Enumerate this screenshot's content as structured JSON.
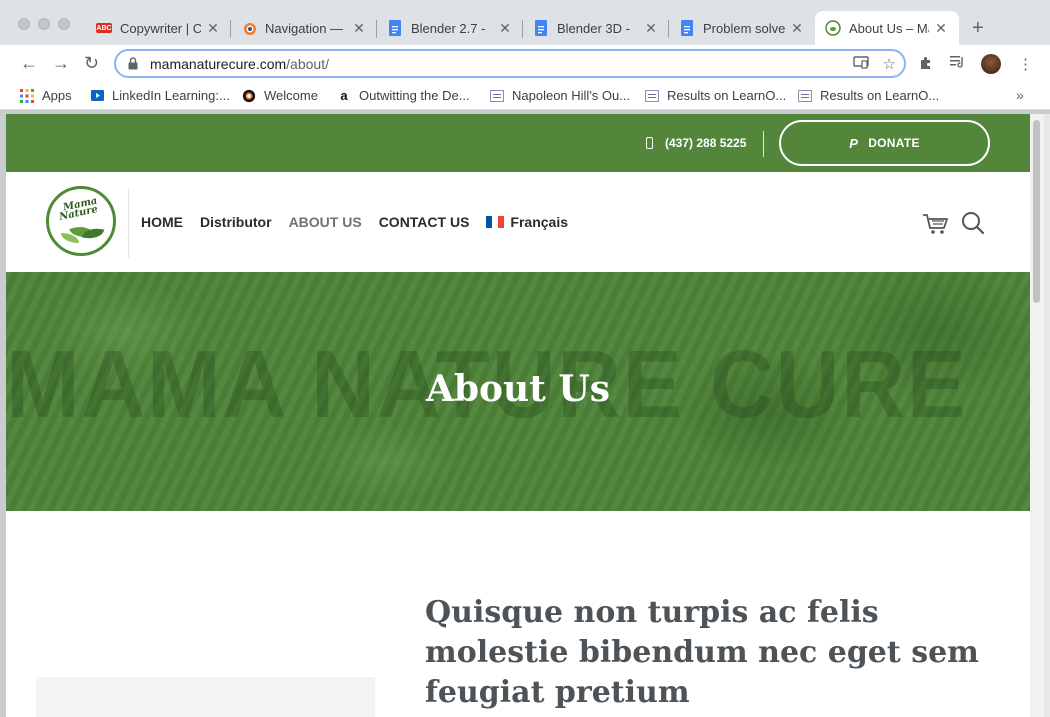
{
  "browser": {
    "tabs": [
      {
        "title": "Copywriter | C",
        "favicon": "abc-icon"
      },
      {
        "title": "Navigation — ",
        "favicon": "blender-icon"
      },
      {
        "title": "Blender 2.7 - ",
        "favicon": "docs-icon"
      },
      {
        "title": "Blender 3D - ",
        "favicon": "docs-icon"
      },
      {
        "title": "Problem solve",
        "favicon": "docs-icon"
      },
      {
        "title": "About Us – Ma",
        "favicon": "mama-nature-icon",
        "active": true
      }
    ],
    "url_domain": "mamanaturecure.com",
    "url_path": "/about/",
    "bookmarks": [
      {
        "label": "Apps",
        "icon": "apps-grid-icon"
      },
      {
        "label": "LinkedIn Learning:...",
        "icon": "linkedin-learning-icon"
      },
      {
        "label": "Welcome",
        "icon": "blender-icon"
      },
      {
        "label": "Outwitting the De...",
        "icon": "amazon-icon"
      },
      {
        "label": "Napoleon Hill's Ou...",
        "icon": "page-icon"
      },
      {
        "label": "Results on LearnO...",
        "icon": "page-icon"
      },
      {
        "label": "Results on LearnO...",
        "icon": "page-icon"
      }
    ]
  },
  "site": {
    "phone": "(437) 288 5225",
    "donate_label": "DONATE",
    "logo": {
      "line1": "Mama",
      "line2": "Nature"
    },
    "nav": [
      {
        "label": "HOME"
      },
      {
        "label": "Distributor"
      },
      {
        "label": "ABOUT US",
        "current": true
      },
      {
        "label": "CONTACT US"
      },
      {
        "label": "Français",
        "flag": "france-flag-icon"
      }
    ],
    "hero": {
      "watermark": "MAMA NATURE CURE",
      "title": "About Us"
    },
    "content": {
      "heading": "Quisque non turpis ac felis molestie bibendum nec eget sem feugiat pretium"
    },
    "colors": {
      "brand_green": "#53853b",
      "nav_text": "#2b2b2b",
      "nav_current": "#6d7376",
      "heading_text": "#4d5357"
    }
  }
}
